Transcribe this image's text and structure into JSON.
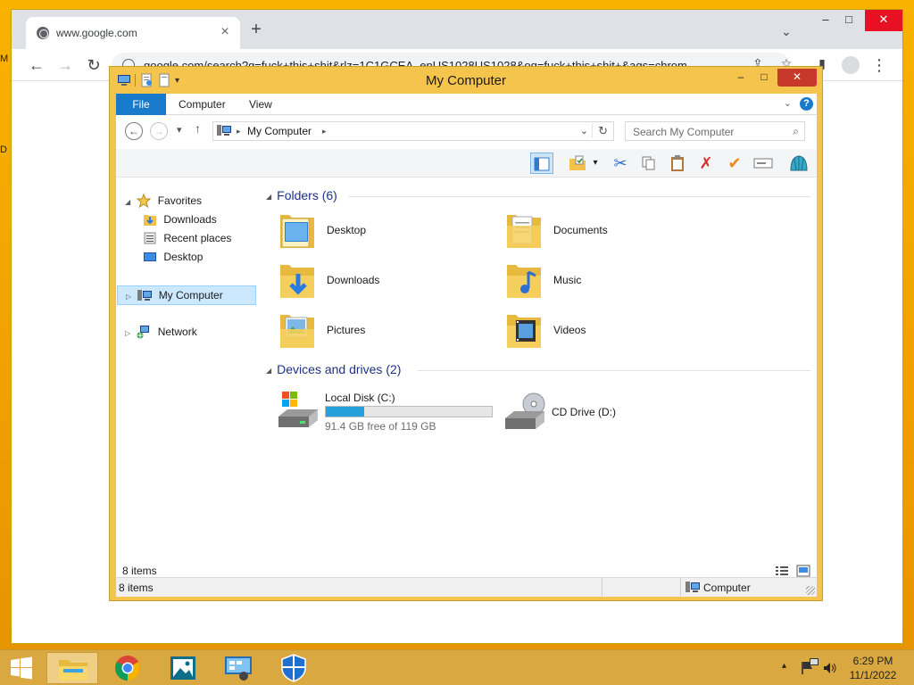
{
  "browser": {
    "tab_title": "www.google.com",
    "url": "google.com/search?q=fuck+this+shit&rlz=1C1GCEA_enUS1028US1028&oq=fuck+this+shit+&aqs=chrom",
    "icons": {
      "close_tab": "×",
      "new_tab": "+",
      "back": "←",
      "forward": "→",
      "reload": "↻",
      "share": "⇪",
      "star": "☆",
      "side_panel": "▮",
      "menu": "⋮",
      "tab_search": "⌄",
      "minimize": "–",
      "maximize": "□",
      "close": "✕"
    }
  },
  "desktop": {
    "fragment_top": "M",
    "fragment_mid": "D"
  },
  "explorer": {
    "title": "My Computer",
    "window_controls": {
      "minimize": "–",
      "maximize": "□",
      "close": "✕"
    },
    "ribbon_tabs": [
      "File",
      "Computer",
      "View"
    ],
    "ribbon_icons": {
      "expand": "⌄",
      "help": "?"
    },
    "nav_icons": {
      "back": "←",
      "forward": "→",
      "recent": "▾",
      "up": "↑"
    },
    "address": {
      "crumb": "My Computer",
      "crumb_sep": "▸",
      "dropdown": "⌄",
      "refresh": "↻"
    },
    "search": {
      "placeholder": "Search My Computer",
      "icon": "⌕"
    },
    "toolbar_glyphs": {
      "properties_arrow": "▾",
      "cut": "✂",
      "delete": "✗",
      "check": "✔"
    },
    "nav_tree": {
      "expand_glyph": "◢",
      "collapsed_glyph": "▷",
      "favorites": "Favorites",
      "downloads": "Downloads",
      "recent_places": "Recent places",
      "desktop": "Desktop",
      "my_computer": "My Computer",
      "network": "Network"
    },
    "folders_header": "Folders (6)",
    "folders": [
      {
        "name": "Desktop"
      },
      {
        "name": "Documents"
      },
      {
        "name": "Downloads"
      },
      {
        "name": "Music"
      },
      {
        "name": "Pictures"
      },
      {
        "name": "Videos"
      }
    ],
    "devices_header": "Devices and drives (2)",
    "drives": [
      {
        "name": "Local Disk (C:)",
        "free_text": "91.4 GB free of 119 GB",
        "used_fraction": 0.232
      },
      {
        "name": "CD Drive (D:)"
      }
    ],
    "inner_status": "8 items",
    "status_count": "8 items",
    "status_zone": "Computer"
  },
  "taskbar": {
    "time": "6:29 PM",
    "date": "11/1/2022",
    "tray_arrow": "▴"
  },
  "colors": {
    "accent_blue": "#1979ca",
    "window_frame": "#f4c44c",
    "desktop": "#f5a800",
    "progress": "#26a0da"
  }
}
